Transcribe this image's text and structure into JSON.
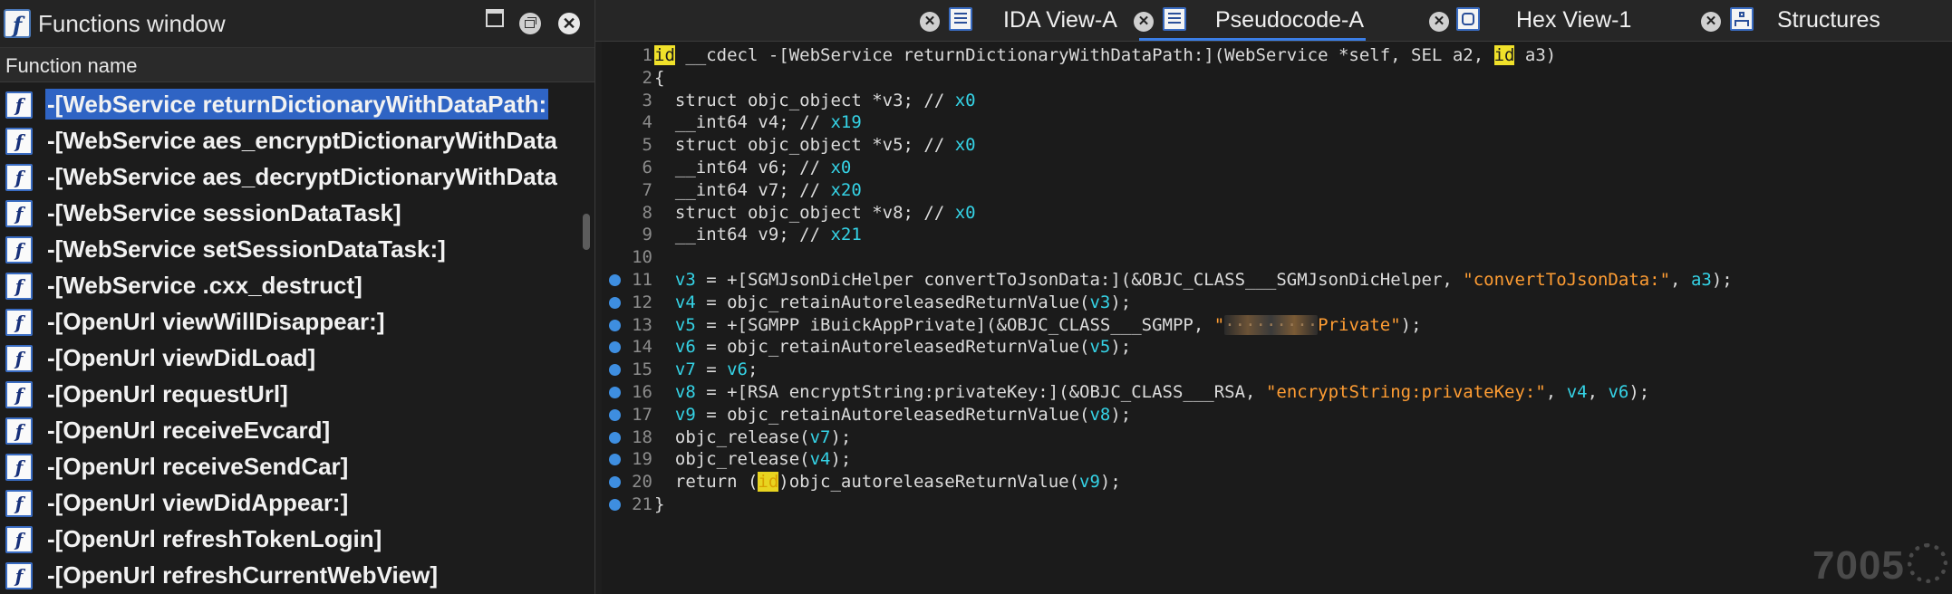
{
  "functions_window": {
    "title": "Functions window",
    "icon_glyph": "f",
    "column_header": "Function name",
    "buttons": {
      "close_glyph": "✕"
    },
    "items": [
      {
        "label": "-[WebService returnDictionaryWithDataPath:",
        "selected": true
      },
      {
        "label": "-[WebService aes_encryptDictionaryWithData"
      },
      {
        "label": "-[WebService aes_decryptDictionaryWithData"
      },
      {
        "label": "-[WebService sessionDataTask]"
      },
      {
        "label": "-[WebService setSessionDataTask:]"
      },
      {
        "label": "-[WebService .cxx_destruct]"
      },
      {
        "label": "-[OpenUrl viewWillDisappear:]"
      },
      {
        "label": "-[OpenUrl viewDidLoad]"
      },
      {
        "label": "-[OpenUrl requestUrl]"
      },
      {
        "label": "-[OpenUrl receiveEvcard]"
      },
      {
        "label": "-[OpenUrl receiveSendCar]"
      },
      {
        "label": "-[OpenUrl viewDidAppear:]"
      },
      {
        "label": "-[OpenUrl refreshTokenLogin]"
      },
      {
        "label": "-[OpenUrl refreshCurrentWebView]"
      }
    ]
  },
  "tabs": [
    {
      "label": "IDA View-A",
      "icon": "ida-view-icon"
    },
    {
      "label": "Pseudocode-A",
      "icon": "pseudocode-icon",
      "active": true
    },
    {
      "label": "Hex View-1",
      "icon": "hex-view-icon"
    },
    {
      "label": "Structures",
      "icon": "structures-icon"
    }
  ],
  "tab_close_glyph": "✕",
  "pseudocode": {
    "lines": [
      {
        "n": "1",
        "bp": false,
        "parts": [
          [
            "id",
            "hl"
          ],
          [
            " __cdecl -[WebService returnDictionaryWithDataPath:](WebService *self, SEL a2, ",
            ""
          ],
          [
            "id",
            "hl"
          ],
          [
            " a3)",
            ""
          ]
        ]
      },
      {
        "n": "2",
        "bp": false,
        "parts": [
          [
            "{",
            ""
          ]
        ]
      },
      {
        "n": "3",
        "bp": false,
        "parts": [
          [
            "  struct objc_object *v3; // ",
            ""
          ],
          [
            "x0",
            "com"
          ]
        ]
      },
      {
        "n": "4",
        "bp": false,
        "parts": [
          [
            "  __int64 v4; // ",
            ""
          ],
          [
            "x19",
            "com"
          ]
        ]
      },
      {
        "n": "5",
        "bp": false,
        "parts": [
          [
            "  struct objc_object *v5; // ",
            ""
          ],
          [
            "x0",
            "com"
          ]
        ]
      },
      {
        "n": "6",
        "bp": false,
        "parts": [
          [
            "  __int64 v6; // ",
            ""
          ],
          [
            "x0",
            "com"
          ]
        ]
      },
      {
        "n": "7",
        "bp": false,
        "parts": [
          [
            "  __int64 v7; // ",
            ""
          ],
          [
            "x20",
            "com"
          ]
        ]
      },
      {
        "n": "8",
        "bp": false,
        "parts": [
          [
            "  struct objc_object *v8; // ",
            ""
          ],
          [
            "x0",
            "com"
          ]
        ]
      },
      {
        "n": "9",
        "bp": false,
        "parts": [
          [
            "  __int64 v9; // ",
            ""
          ],
          [
            "x21",
            "com"
          ]
        ]
      },
      {
        "n": "10",
        "bp": false,
        "parts": []
      },
      {
        "n": "11",
        "bp": true,
        "parts": [
          [
            "  ",
            ""
          ],
          [
            "v3",
            "var"
          ],
          [
            " = +[SGMJsonDicHelper convertToJsonData:](&OBJC_CLASS___SGMJsonDicHelper, ",
            ""
          ],
          [
            "\"convertToJsonData:\"",
            "str"
          ],
          [
            ", ",
            ""
          ],
          [
            "a3",
            "var"
          ],
          [
            ");",
            ""
          ]
        ]
      },
      {
        "n": "12",
        "bp": true,
        "parts": [
          [
            "  ",
            ""
          ],
          [
            "v4",
            "var"
          ],
          [
            " = objc_retainAutoreleasedReturnValue(",
            ""
          ],
          [
            "v3",
            "var"
          ],
          [
            ");",
            ""
          ]
        ]
      },
      {
        "n": "13",
        "bp": true,
        "parts": [
          [
            "  ",
            ""
          ],
          [
            "v5",
            "var"
          ],
          [
            " = +[SGMPP iBuickAppPrivate](&OBJC_CLASS___SGMPP, ",
            ""
          ],
          [
            "\"",
            "str"
          ],
          [
            "·········",
            "blur"
          ],
          [
            "Private\"",
            "str"
          ],
          [
            ");",
            ""
          ]
        ]
      },
      {
        "n": "14",
        "bp": true,
        "parts": [
          [
            "  ",
            ""
          ],
          [
            "v6",
            "var"
          ],
          [
            " = objc_retainAutoreleasedReturnValue(",
            ""
          ],
          [
            "v5",
            "var"
          ],
          [
            ");",
            ""
          ]
        ]
      },
      {
        "n": "15",
        "bp": true,
        "parts": [
          [
            "  ",
            ""
          ],
          [
            "v7",
            "var"
          ],
          [
            " = ",
            ""
          ],
          [
            "v6",
            "var"
          ],
          [
            ";",
            ""
          ]
        ]
      },
      {
        "n": "16",
        "bp": true,
        "parts": [
          [
            "  ",
            ""
          ],
          [
            "v8",
            "var"
          ],
          [
            " = +[RSA encryptString:privateKey:](&OBJC_CLASS___RSA, ",
            ""
          ],
          [
            "\"encryptString:privateKey:\"",
            "str"
          ],
          [
            ", ",
            ""
          ],
          [
            "v4",
            "var"
          ],
          [
            ", ",
            ""
          ],
          [
            "v6",
            "var"
          ],
          [
            ");",
            ""
          ]
        ]
      },
      {
        "n": "17",
        "bp": true,
        "parts": [
          [
            "  ",
            ""
          ],
          [
            "v9",
            "var"
          ],
          [
            " = objc_retainAutoreleasedReturnValue(",
            ""
          ],
          [
            "v8",
            "var"
          ],
          [
            ");",
            ""
          ]
        ]
      },
      {
        "n": "18",
        "bp": true,
        "parts": [
          [
            "  objc_release(",
            ""
          ],
          [
            "v7",
            "var"
          ],
          [
            ");",
            ""
          ]
        ]
      },
      {
        "n": "19",
        "bp": true,
        "parts": [
          [
            "  objc_release(",
            ""
          ],
          [
            "v4",
            "var"
          ],
          [
            ");",
            ""
          ]
        ]
      },
      {
        "n": "20",
        "bp": true,
        "parts": [
          [
            "  return (",
            ""
          ],
          [
            "id",
            "hl2"
          ],
          [
            ")objc_autoreleaseReturnValue(",
            ""
          ],
          [
            "v9",
            "var"
          ],
          [
            ");",
            ""
          ]
        ]
      },
      {
        "n": "21",
        "bp": true,
        "parts": [
          [
            "}",
            ""
          ]
        ]
      }
    ]
  },
  "watermark": "7005"
}
